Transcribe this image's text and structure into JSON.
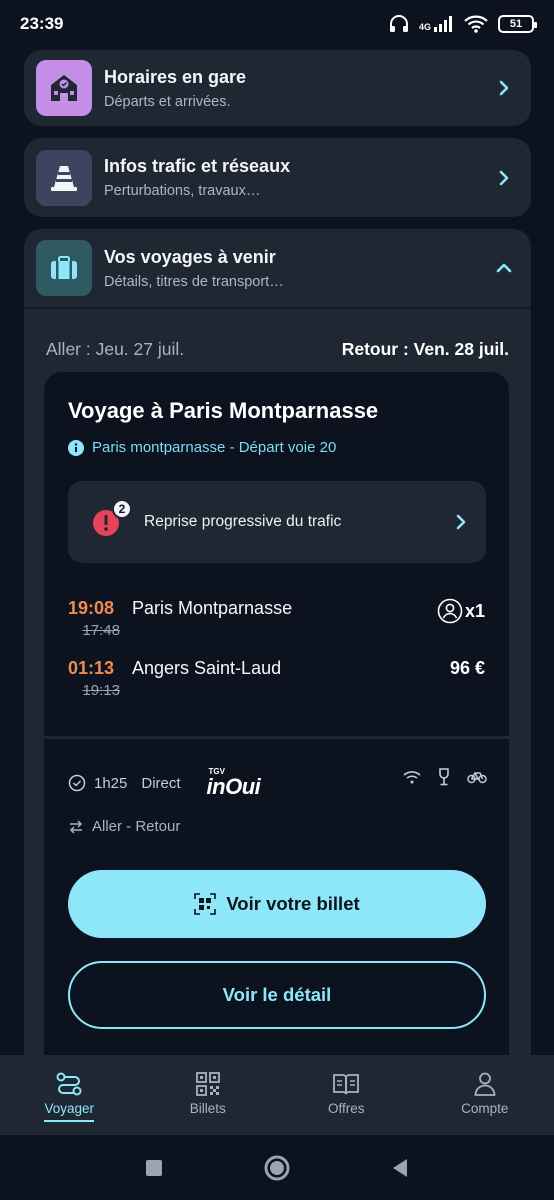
{
  "status": {
    "time": "23:39",
    "network": "4G",
    "battery": "51"
  },
  "menu": [
    {
      "title": "Horaires en gare",
      "subtitle": "Départs et arrivées.",
      "icon": "station-icon"
    },
    {
      "title": "Infos trafic et réseaux",
      "subtitle": "Perturbations, travaux…",
      "icon": "traffic-cone-icon"
    },
    {
      "title": "Vos voyages à venir",
      "subtitle": "Détails, titres de transport…",
      "icon": "suitcase-icon"
    }
  ],
  "trip": {
    "aller": "Aller : Jeu. 27 juil.",
    "retour": "Retour : Ven. 28 juil.",
    "title": "Voyage à Paris Montparnasse",
    "info": "Paris montparnasse - Départ voie 20",
    "alert": {
      "count": "2",
      "text": "Reprise progressive du trafic"
    },
    "departure": {
      "new_time": "19:08",
      "old_time": "17:48",
      "station": "Paris Montparnasse",
      "passengers": "x1"
    },
    "arrival": {
      "new_time": "01:13",
      "old_time": "19:13",
      "station": "Angers Saint-Laud",
      "price": "96 €"
    },
    "duration": "1h25",
    "direct": "Direct",
    "brand_top": "TGV",
    "brand": "inOui",
    "round_trip": "Aller - Retour",
    "btn_ticket": "Voir votre billet",
    "btn_detail": "Voir le détail"
  },
  "nav": [
    {
      "label": "Voyager",
      "active": true
    },
    {
      "label": "Billets"
    },
    {
      "label": "Offres"
    },
    {
      "label": "Compte"
    }
  ],
  "colors": {
    "accent": "#8ee6f9",
    "delay": "#f08a50",
    "alert": "#e8415a",
    "background": "#0c131f",
    "card": "#1f2733"
  }
}
